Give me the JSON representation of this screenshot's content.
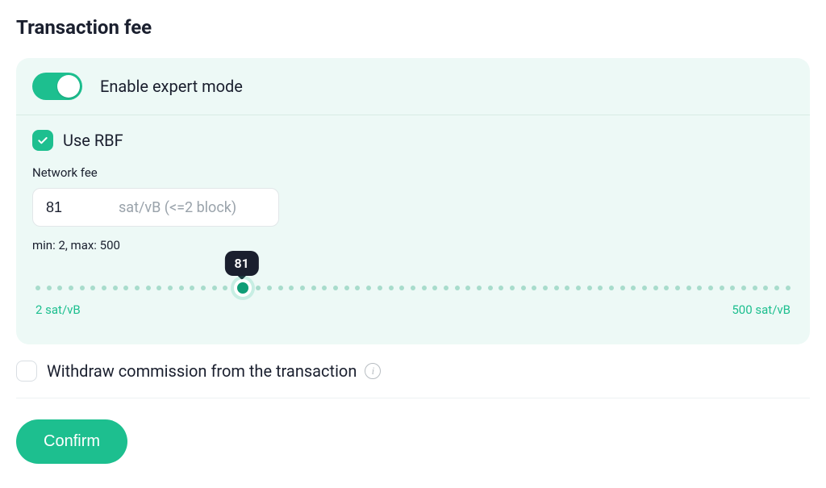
{
  "title": "Transaction fee",
  "expert": {
    "label": "Enable expert mode",
    "enabled": true
  },
  "rbf": {
    "label": "Use RBF",
    "checked": true
  },
  "fee": {
    "label": "Network fee",
    "value": "81",
    "unit_hint": "sat/vB (<=2 block)",
    "minmax_text": "min: 2,   max: 500"
  },
  "slider": {
    "value": "81",
    "min_label": "2 sat/vB",
    "max_label": "500 sat/vB",
    "percent": 27.5
  },
  "withdraw": {
    "label": "Withdraw commission from the transaction",
    "checked": false
  },
  "confirm_label": "Confirm"
}
